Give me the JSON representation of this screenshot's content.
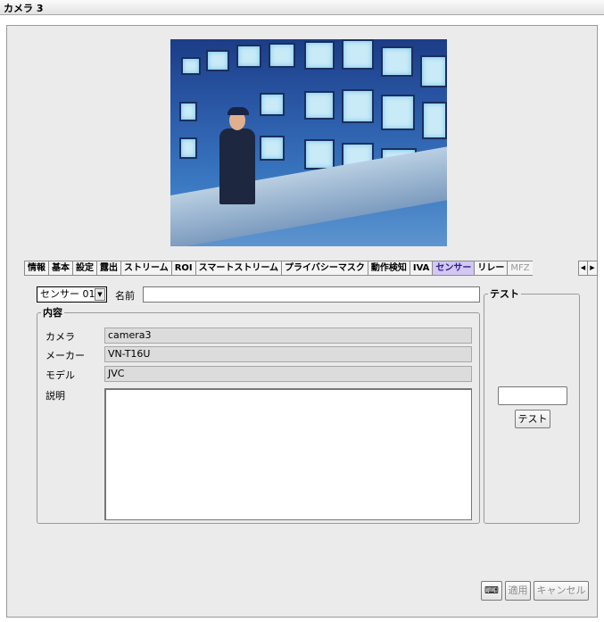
{
  "window": {
    "title": "カメラ 3"
  },
  "tabs": [
    {
      "label": "情報",
      "state": "normal"
    },
    {
      "label": "基本",
      "state": "normal"
    },
    {
      "label": "設定",
      "state": "normal"
    },
    {
      "label": "露出",
      "state": "normal"
    },
    {
      "label": "ストリーム",
      "state": "normal"
    },
    {
      "label": "ROI",
      "state": "normal"
    },
    {
      "label": "スマートストリーム",
      "state": "normal"
    },
    {
      "label": "プライバシーマスク",
      "state": "normal"
    },
    {
      "label": "動作検知",
      "state": "normal"
    },
    {
      "label": "IVA",
      "state": "normal"
    },
    {
      "label": "センサー",
      "state": "active"
    },
    {
      "label": "リレー",
      "state": "normal"
    },
    {
      "label": "MFZ",
      "state": "disabled"
    }
  ],
  "tab_scroll": {
    "left_icon": "◀",
    "right_icon": "▶"
  },
  "sensor": {
    "selected": "センサー 01",
    "name_label": "名前",
    "name_value": ""
  },
  "content": {
    "legend": "内容",
    "camera_label": "カメラ",
    "camera_value": "camera3",
    "maker_label": "メーカー",
    "maker_value": "VN-T16U",
    "model_label": "モデル",
    "model_value": "JVC",
    "description_label": "説明",
    "description_value": ""
  },
  "test": {
    "legend": "テスト",
    "input_value": "",
    "button_label": "テスト"
  },
  "footer": {
    "keyboard_icon": "⌨",
    "apply_label": "適用",
    "cancel_label": "キャンセル"
  },
  "colors": {
    "active_tab": "#d3c7f3",
    "panel": "#ebebeb"
  }
}
